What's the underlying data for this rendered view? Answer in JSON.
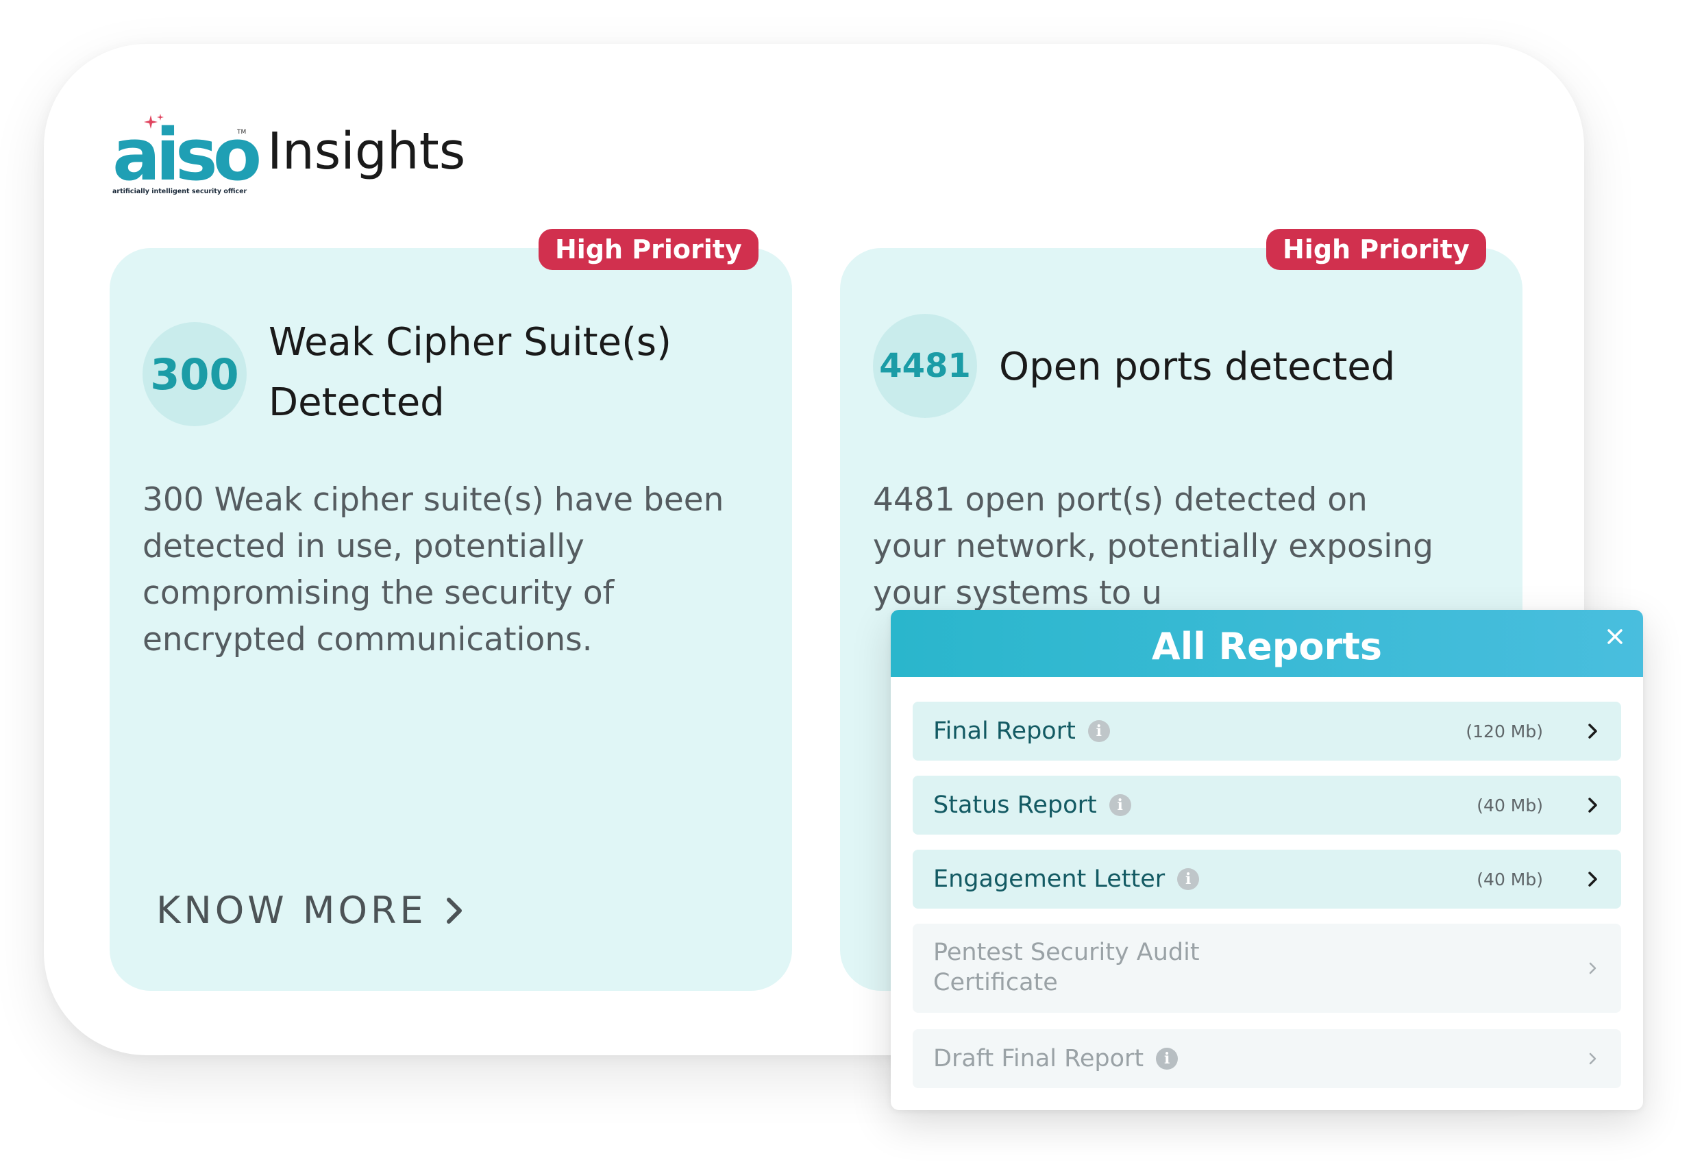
{
  "header": {
    "logo_text": "aiso",
    "logo_trademark": "TM",
    "logo_tagline": "artificially intelligent security officer",
    "title": "Insights"
  },
  "cards": [
    {
      "priority": "High Priority",
      "count": "300",
      "title": "Weak Cipher Suite(s) Detected",
      "description": "300 Weak cipher suite(s) have been detected in use, potentially compromising the security of encrypted communications.",
      "action": "KNOW MORE"
    },
    {
      "priority": "High Priority",
      "count": "4481",
      "title": "Open ports detected",
      "description": "4481 open port(s) detected on your network, potentially exposing your systems to u"
    }
  ],
  "reports_modal": {
    "title": "All Reports",
    "items": [
      {
        "label": "Final Report",
        "size": "(120 Mb)",
        "enabled": true
      },
      {
        "label": "Status Report",
        "size": "(40 Mb)",
        "enabled": true
      },
      {
        "label": "Engagement Letter",
        "size": "(40 Mb)",
        "enabled": true
      },
      {
        "label": "Pentest Security Audit Certificate",
        "size": "",
        "enabled": false
      },
      {
        "label": "Draft Final Report",
        "size": "",
        "enabled": false
      }
    ]
  },
  "colors": {
    "brand": "#1f9fb4",
    "card_bg": "#e0f6f6",
    "priority_badge": "#d1304e",
    "modal_header": "#2ab6cc"
  }
}
